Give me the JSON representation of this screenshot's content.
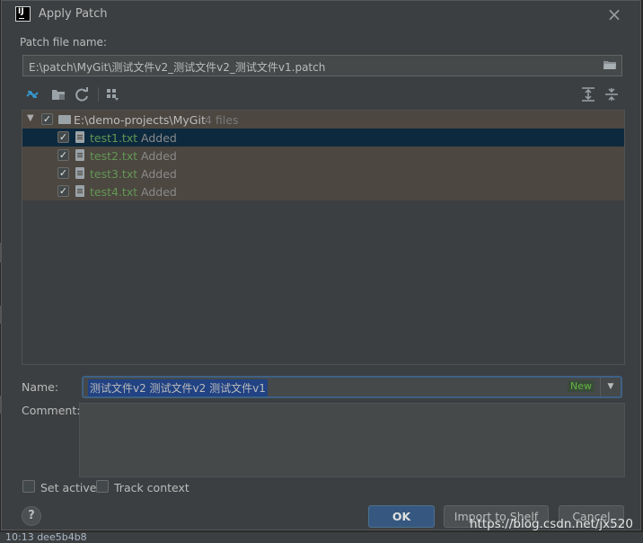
{
  "dialog": {
    "title": "Apply Patch",
    "app_icon": "IJ",
    "close_glyph": "×"
  },
  "patch_file": {
    "label": "Patch file name:",
    "value": "E:\\patch\\MyGit\\测试文件v2_测试文件v2_测试文件v1.patch"
  },
  "toolbar": {
    "icons": [
      "merge-arrows-icon",
      "folder-icon",
      "refresh-icon",
      "group-by-icon",
      "expand-all-icon",
      "collapse-all-icon"
    ]
  },
  "tree": {
    "root": {
      "path": "E:\\demo-projects\\MyGit",
      "count": "4 files",
      "checked": true
    },
    "files": [
      {
        "name": "test1.txt",
        "status": "Added",
        "checked": true,
        "selected": true
      },
      {
        "name": "test2.txt",
        "status": "Added",
        "checked": true,
        "selected": false
      },
      {
        "name": "test3.txt",
        "status": "Added",
        "checked": true,
        "selected": false
      },
      {
        "name": "test4.txt",
        "status": "Added",
        "checked": true,
        "selected": false
      }
    ],
    "check_glyph": "✓",
    "expander_glyph": "▼"
  },
  "name": {
    "label": "Name:",
    "value": "测试文件v2 测试文件v2 测试文件v1",
    "badge": "New",
    "dropdown_glyph": "▼"
  },
  "comment": {
    "label": "Comment:",
    "value": ""
  },
  "options": {
    "set_active": {
      "label": "Set active",
      "checked": false
    },
    "track_context": {
      "label": "Track context",
      "checked": false
    }
  },
  "buttons": {
    "help": "?",
    "ok": "OK",
    "import": "Import to Shelf",
    "cancel": "Cancel"
  },
  "background": {
    "status_text": "10:13   dee5b4b8"
  },
  "watermark": "https://blog.csdn.net/jx520",
  "colors": {
    "dialog_bg": "#3c3f41",
    "row_bg": "#4c4740",
    "selected_row": "#0d293e",
    "added_file": "#629755",
    "ok_button": "#365880",
    "new_badge": "#62b543"
  }
}
